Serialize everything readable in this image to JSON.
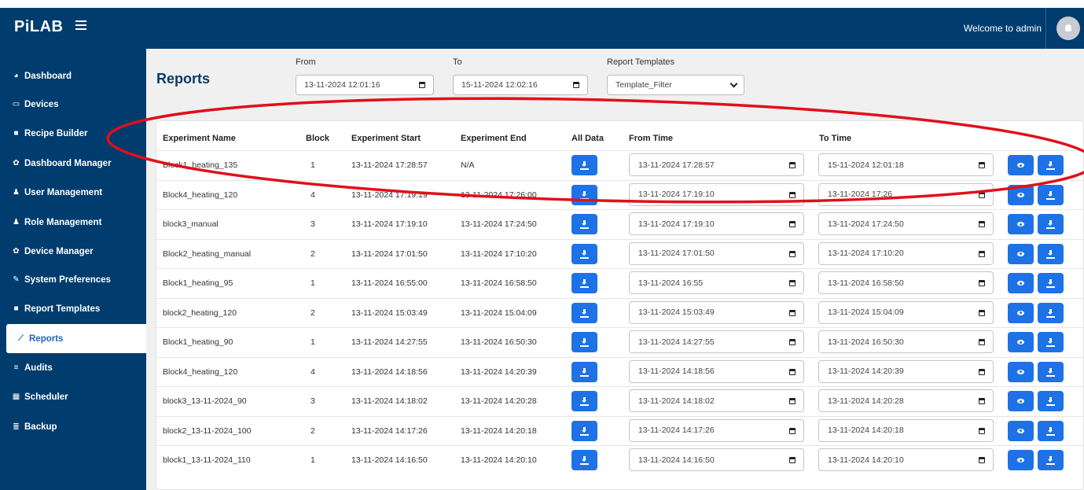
{
  "app": {
    "brand": "PiLAB",
    "welcome": "Welcome to admin"
  },
  "sidebar": {
    "items": [
      {
        "label": "Dashboard",
        "icon": "tachometer-icon",
        "glyph": "◕"
      },
      {
        "label": "Devices",
        "icon": "devices-icon",
        "glyph": "▭"
      },
      {
        "label": "Recipe Builder",
        "icon": "file-icon",
        "glyph": "■"
      },
      {
        "label": "Dashboard Manager",
        "icon": "gear-icon",
        "glyph": "✿"
      },
      {
        "label": "User Management",
        "icon": "user-icon",
        "glyph": "♟"
      },
      {
        "label": "Role Management",
        "icon": "users-icon",
        "glyph": "♟"
      },
      {
        "label": "Device Manager",
        "icon": "gear-icon",
        "glyph": "✿"
      },
      {
        "label": "System Preferences",
        "icon": "wrench-icon",
        "glyph": "✎"
      },
      {
        "label": "Report Templates",
        "icon": "file-icon",
        "glyph": "■"
      },
      {
        "label": "Reports",
        "icon": "chart-line-icon",
        "glyph": "⟋",
        "active": true
      },
      {
        "label": "Audits",
        "icon": "list-icon",
        "glyph": "≡"
      },
      {
        "label": "Scheduler",
        "icon": "calendar-icon",
        "glyph": "▦"
      },
      {
        "label": "Backup",
        "icon": "database-icon",
        "glyph": "≣"
      }
    ]
  },
  "filters": {
    "title": "Reports",
    "from_label": "From",
    "from_value": "13-11-2024 12:01:16",
    "to_label": "To",
    "to_value": "15-11-2024 12:02:16",
    "template_label": "Report Templates",
    "template_value": "Template_Filter"
  },
  "table": {
    "headers": [
      "Experiment Name",
      "Block",
      "Experiment Start",
      "Experiment End",
      "All Data",
      "From Time",
      "To Time"
    ],
    "rows": [
      {
        "name": "Block1_heating_135",
        "block": "1",
        "start": "13-11-2024 17:28:57",
        "end": "N/A",
        "from": "13-11-2024 17:28:57",
        "to": "15-11-2024 12:01:18"
      },
      {
        "name": "Block4_heating_120",
        "block": "4",
        "start": "13-11-2024 17:19:19",
        "end": "13-11-2024 17:26:00",
        "from": "13-11-2024 17:19:10",
        "to": "13-11-2024 17:26"
      },
      {
        "name": "block3_manual",
        "block": "3",
        "start": "13-11-2024 17:19:10",
        "end": "13-11-2024 17:24:50",
        "from": "13-11-2024 17:19:10",
        "to": "13-11-2024 17:24:50"
      },
      {
        "name": "Block2_heating_manual",
        "block": "2",
        "start": "13-11-2024 17:01:50",
        "end": "13-11-2024 17:10:20",
        "from": "13-11-2024 17:01:50",
        "to": "13-11-2024 17:10:20"
      },
      {
        "name": "Block1_heating_95",
        "block": "1",
        "start": "13-11-2024 16:55:00",
        "end": "13-11-2024 16:58:50",
        "from": "13-11-2024 16:55",
        "to": "13-11-2024 16:58:50"
      },
      {
        "name": "block2_heating_120",
        "block": "2",
        "start": "13-11-2024 15:03:49",
        "end": "13-11-2024 15:04:09",
        "from": "13-11-2024 15:03:49",
        "to": "13-11-2024 15:04:09"
      },
      {
        "name": "Block1_heating_90",
        "block": "1",
        "start": "13-11-2024 14:27:55",
        "end": "13-11-2024 16:50:30",
        "from": "13-11-2024 14:27:55",
        "to": "13-11-2024 16:50:30"
      },
      {
        "name": "Block4_heating_120",
        "block": "4",
        "start": "13-11-2024 14:18:56",
        "end": "13-11-2024 14:20:39",
        "from": "13-11-2024 14:18:56",
        "to": "13-11-2024 14:20:39"
      },
      {
        "name": "block3_13-11-2024_90",
        "block": "3",
        "start": "13-11-2024 14:18:02",
        "end": "13-11-2024 14:20:28",
        "from": "13-11-2024 14:18:02",
        "to": "13-11-2024 14:20:28"
      },
      {
        "name": "block2_13-11-2024_100",
        "block": "2",
        "start": "13-11-2024 14:17:26",
        "end": "13-11-2024 14:20:18",
        "from": "13-11-2024 14:17:26",
        "to": "13-11-2024 14:20:18"
      },
      {
        "name": "block1_13-11-2024_110",
        "block": "1",
        "start": "13-11-2024 14:16:50",
        "end": "13-11-2024 14:20:10",
        "from": "13-11-2024 14:16:50",
        "to": "13-11-2024 14:20:10"
      }
    ]
  },
  "colors": {
    "navy": "#003c6e",
    "accent": "#1e72e6",
    "annotation": "#e0101a"
  }
}
